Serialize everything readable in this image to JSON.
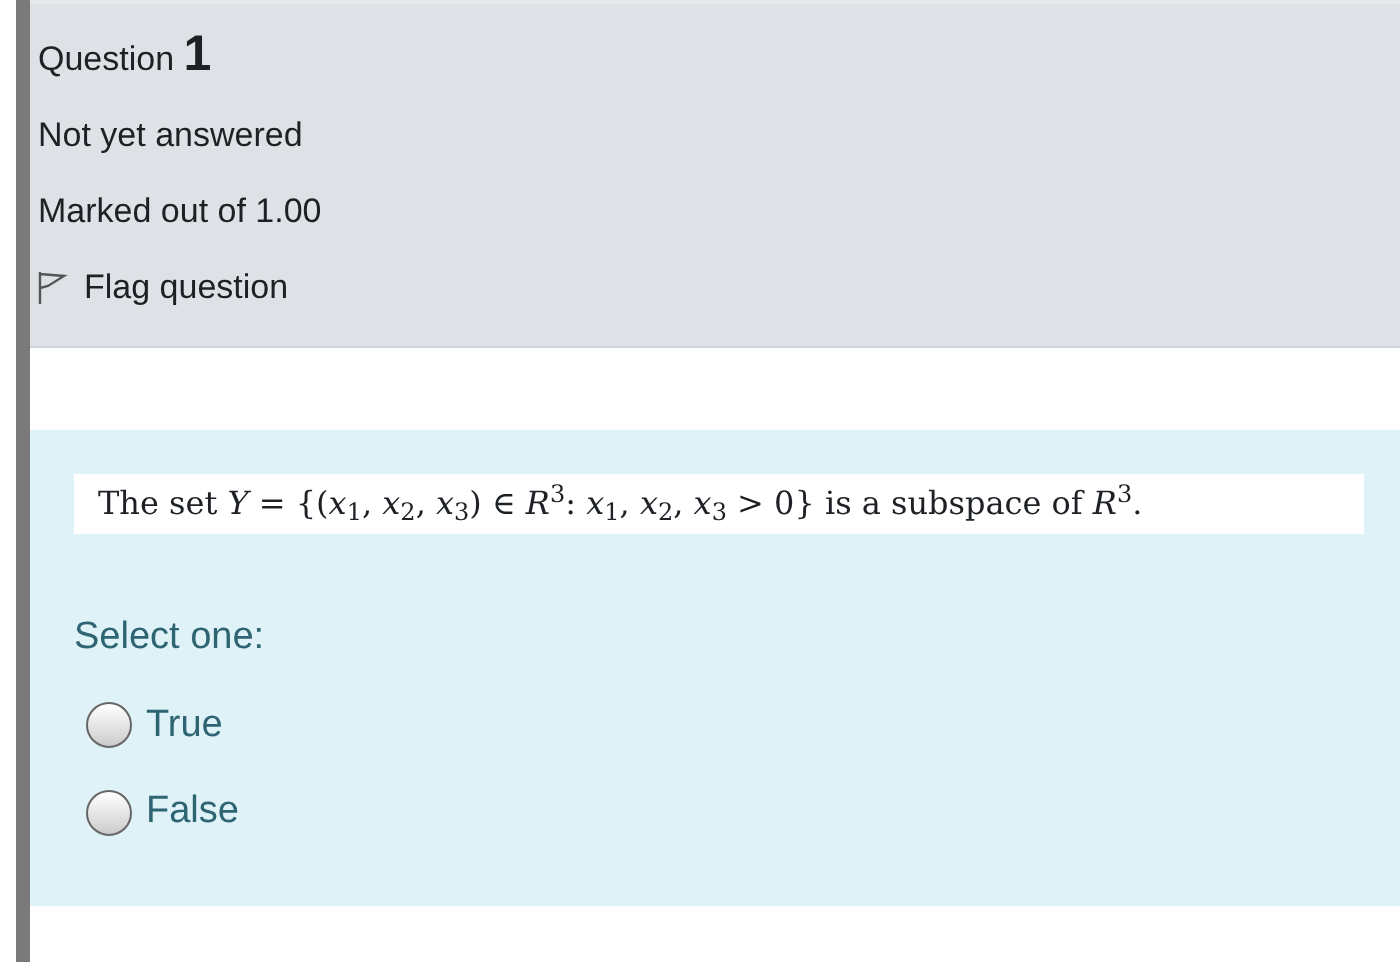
{
  "info": {
    "question_label": "Question",
    "question_number": "1",
    "state": "Not yet answered",
    "marks": "Marked out of 1.00",
    "flag": {
      "label": "Flag question",
      "flagged": false
    }
  },
  "content": {
    "question_text": "The set *Y* = {(*x*$_{1}$, *x*$_{2}$, *x*$_{3}$) ∈ *R*$^{3}$: *x*$_{1}$, *x*$_{2}$, *x*$_{3}$ > 0}  is a subspace of *R*$^{3}$.",
    "prompt": "Select one:",
    "options": [
      {
        "label": "True",
        "selected": false
      },
      {
        "label": "False",
        "selected": false
      }
    ]
  }
}
